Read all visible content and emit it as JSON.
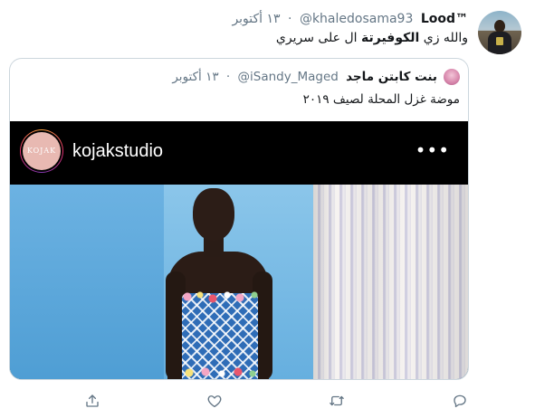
{
  "tweet": {
    "author_name": "Lood™",
    "author_handle": "@khaledosama93",
    "separator": "·",
    "time": "١٣ أكتوبر",
    "text_before": "والله زي ",
    "text_bold": "الكوفيرتة",
    "text_after": " ال على سريري"
  },
  "quote": {
    "author_name": "بنت كابتن ماجد",
    "author_handle": "@iSandy_Maged",
    "separator": "·",
    "time": "١٣ أكتوبر",
    "text": "موضة غزل المحلة لصيف ٢٠١٩",
    "media": {
      "ig_username": "kojakstudio",
      "ig_logo_text": "KOJAK",
      "more_icon": "•••"
    }
  },
  "actions": {
    "icons": [
      "share-icon",
      "like-icon",
      "retweet-icon",
      "reply-icon"
    ]
  },
  "colors": {
    "muted": "#657786",
    "border": "#ccd6dd",
    "text": "#14171a"
  }
}
